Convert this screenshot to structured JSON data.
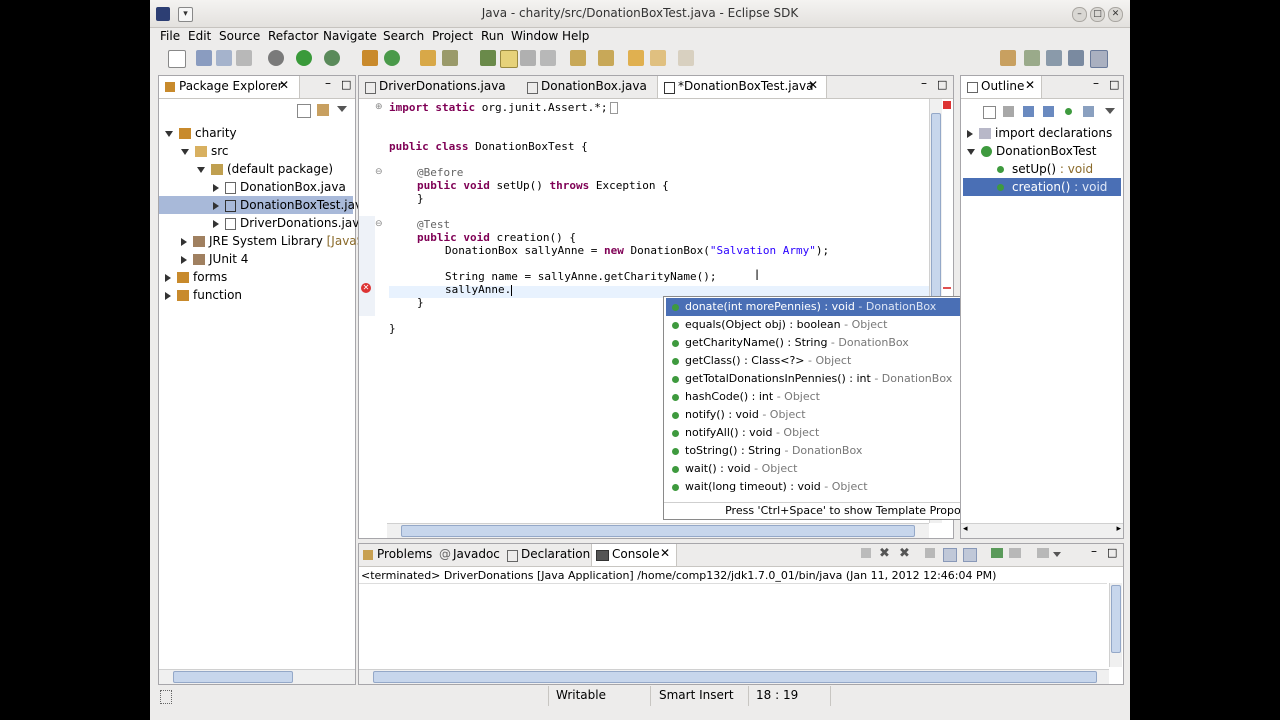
{
  "window": {
    "title": "Java - charity/src/DonationBoxTest.java - Eclipse SDK"
  },
  "menu": [
    "File",
    "Edit",
    "Source",
    "Refactor",
    "Navigate",
    "Search",
    "Project",
    "Run",
    "Window",
    "Help"
  ],
  "package_explorer": {
    "tab_label": "Package Explorer",
    "tree": [
      {
        "label": "charity",
        "depth": 0,
        "state": "open"
      },
      {
        "label": "src",
        "depth": 1,
        "state": "open"
      },
      {
        "label": "(default package)",
        "depth": 2,
        "state": "open"
      },
      {
        "label": "DonationBox.java",
        "depth": 3,
        "state": "closed"
      },
      {
        "label": "DonationBoxTest.jav",
        "depth": 3,
        "state": "closed",
        "selected": true
      },
      {
        "label": "DriverDonations.java",
        "depth": 3,
        "state": "closed"
      },
      {
        "label": "JRE System Library",
        "suffix": "[JavaSE",
        "depth": 1,
        "state": "closed"
      },
      {
        "label": "JUnit 4",
        "depth": 1,
        "state": "closed"
      },
      {
        "label": "forms",
        "depth": 0,
        "state": "closed"
      },
      {
        "label": "function",
        "depth": 0,
        "state": "closed"
      }
    ]
  },
  "editor": {
    "tabs": [
      {
        "label": "DriverDonations.java"
      },
      {
        "label": "DonationBox.java"
      },
      {
        "label": "*DonationBoxTest.java",
        "active": true
      }
    ],
    "code": {
      "import_kw": "import static",
      "import_rest": " org.junit.Assert.*;",
      "class_decl_kw": "public class",
      "class_decl_rest": " DonationBoxTest {",
      "before_ann": "@Before",
      "setup_kw": "public void",
      "setup_name": " setUp() ",
      "setup_throws": "throws",
      "setup_rest": " Exception {",
      "close_brace": "}",
      "test_ann": "@Test",
      "creation_kw": "public void",
      "creation_rest": " creation() {",
      "line_db_1": "DonationBox sallyAnne = ",
      "line_db_new": "new",
      "line_db_2": " DonationBox(",
      "line_db_str": "\"Salvation Army\"",
      "line_db_3": ");",
      "line_name": "String name = sallyAnne.getCharityName();",
      "line_cursor": "sallyAnne."
    }
  },
  "completion": {
    "items": [
      {
        "main": "donate(int morePennies) : void",
        "owner": " - DonationBox",
        "selected": true
      },
      {
        "main": "equals(Object obj) : boolean",
        "owner": " - Object"
      },
      {
        "main": "getCharityName() : String",
        "owner": " - DonationBox"
      },
      {
        "main": "getClass() : Class<?>",
        "owner": " - Object"
      },
      {
        "main": "getTotalDonationsInPennies() : int",
        "owner": " - DonationBox"
      },
      {
        "main": "hashCode() : int",
        "owner": " - Object"
      },
      {
        "main": "notify() : void",
        "owner": " - Object"
      },
      {
        "main": "notifyAll() : void",
        "owner": " - Object"
      },
      {
        "main": "toString() : String",
        "owner": " - DonationBox"
      },
      {
        "main": "wait() : void",
        "owner": " - Object"
      },
      {
        "main": "wait(long timeout) : void",
        "owner": " - Object"
      }
    ],
    "footer": "Press 'Ctrl+Space' to show Template Proposals"
  },
  "outline": {
    "tab_label": "Outline",
    "items": [
      {
        "label": "import declarations",
        "depth": 0,
        "state": "closed"
      },
      {
        "label": "DonationBoxTest",
        "depth": 0,
        "state": "open"
      },
      {
        "label": "setUp()",
        "type": " : void",
        "depth": 1
      },
      {
        "label": "creation()",
        "type": " : void",
        "depth": 1,
        "selected": true
      }
    ]
  },
  "bottom_panel": {
    "tabs": [
      {
        "label": "Problems"
      },
      {
        "label": "Javadoc"
      },
      {
        "label": "Declaration"
      },
      {
        "label": "Console",
        "active": true
      }
    ],
    "console_header": "<terminated> DriverDonations [Java Application] /home/comp132/jdk1.7.0_01/bin/java (Jan 11, 2012 12:46:04 PM)"
  },
  "status": {
    "writable": "Writable",
    "insert_mode": "Smart Insert",
    "position": "18 : 19"
  },
  "colors": {
    "selection": "#4a6fb5",
    "keyword": "#7f0055",
    "string": "#2a00ff",
    "annotation": "#646464"
  }
}
